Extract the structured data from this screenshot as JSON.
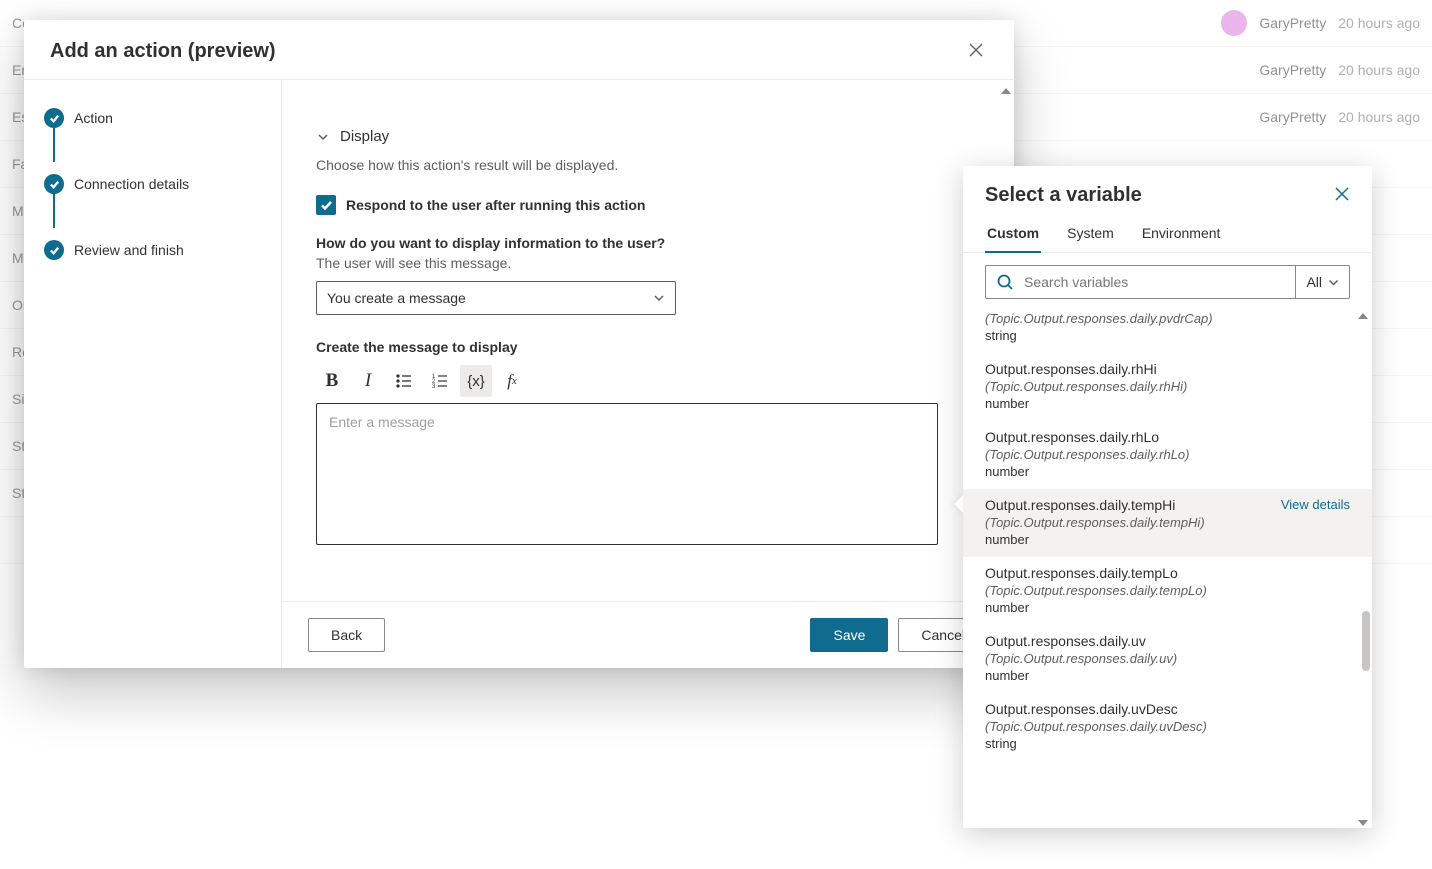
{
  "background": {
    "sidebar_items": [
      "Co",
      "En",
      "Es",
      "Fal",
      "MS",
      "Mu",
      "On",
      "Re",
      "Sig",
      "Sto",
      "Sto"
    ],
    "rows": [
      {
        "user": "GaryPretty",
        "time": "20 hours ago"
      },
      {
        "user": "GaryPretty",
        "time": "20 hours ago"
      },
      {
        "user": "GaryPretty",
        "time": "20 hours ago"
      }
    ]
  },
  "modal": {
    "title": "Add an action (preview)",
    "steps": [
      "Action",
      "Connection details",
      "Review and finish"
    ],
    "display": {
      "section_title": "Display",
      "section_desc": "Choose how this action's result will be displayed.",
      "respond_checkbox_label": "Respond to the user after running this action",
      "q_label": "How do you want to display information to the user?",
      "q_sub": "The user will see this message.",
      "select_value": "You create a message",
      "msg_label": "Create the message to display",
      "editor_placeholder": "Enter a message"
    },
    "footer": {
      "back": "Back",
      "save": "Save",
      "cancel": "Cancel"
    }
  },
  "picker": {
    "title": "Select a variable",
    "tabs": [
      "Custom",
      "System",
      "Environment"
    ],
    "active_tab": "Custom",
    "search_placeholder": "Search variables",
    "filter_label": "All",
    "view_details_label": "View details",
    "partial_top": {
      "path": "(Topic.Output.responses.daily.pvdrCap)",
      "type": "string"
    },
    "variables": [
      {
        "name": "Output.responses.daily.rhHi",
        "path": "(Topic.Output.responses.daily.rhHi)",
        "type": "number"
      },
      {
        "name": "Output.responses.daily.rhLo",
        "path": "(Topic.Output.responses.daily.rhLo)",
        "type": "number"
      },
      {
        "name": "Output.responses.daily.tempHi",
        "path": "(Topic.Output.responses.daily.tempHi)",
        "type": "number",
        "hover": true
      },
      {
        "name": "Output.responses.daily.tempLo",
        "path": "(Topic.Output.responses.daily.tempLo)",
        "type": "number"
      },
      {
        "name": "Output.responses.daily.uv",
        "path": "(Topic.Output.responses.daily.uv)",
        "type": "number"
      },
      {
        "name": "Output.responses.daily.uvDesc",
        "path": "(Topic.Output.responses.daily.uvDesc)",
        "type": "string"
      }
    ]
  }
}
